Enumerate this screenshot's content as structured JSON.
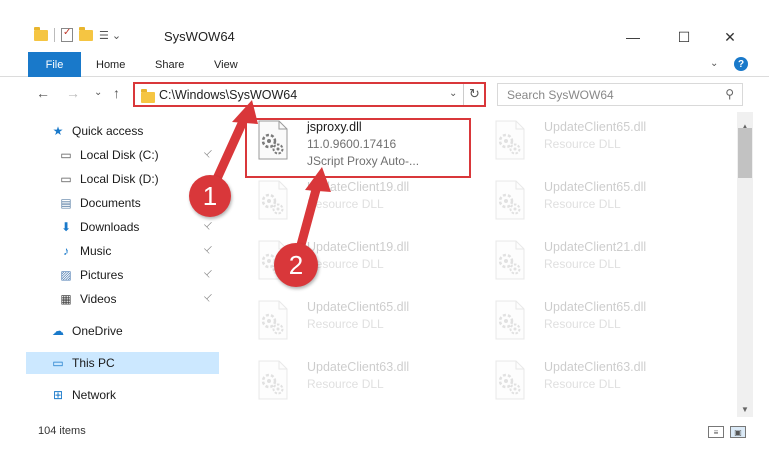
{
  "window": {
    "title": "SysWOW64",
    "minimize": "—",
    "maximize": "☐",
    "close": "✕"
  },
  "ribbon": {
    "tabs": [
      "File",
      "Home",
      "Share",
      "View"
    ],
    "expand_icon": "⌄",
    "help_icon": "?"
  },
  "nav": {
    "back": "←",
    "forward": "→",
    "recent": "⌄",
    "up": "↑",
    "address": "C:\\Windows\\SysWOW64",
    "address_dropdown": "⌄",
    "refresh": "↻",
    "search_placeholder": "Search SysWOW64",
    "search_icon": "⚲"
  },
  "sidebar": {
    "items": [
      {
        "label": "Quick access",
        "icon": "star-icon",
        "glyph": "★",
        "color": "#1979ca"
      },
      {
        "label": "Local Disk (C:)",
        "icon": "drive-icon",
        "glyph": "▭",
        "color": "#555555",
        "pinned": true
      },
      {
        "label": "Local Disk (D:)",
        "icon": "drive-icon",
        "glyph": "▭",
        "color": "#555555"
      },
      {
        "label": "Documents",
        "icon": "documents-icon",
        "glyph": "▤",
        "color": "#5b7fa6"
      },
      {
        "label": "Downloads",
        "icon": "download-icon",
        "glyph": "⬇",
        "color": "#1979ca",
        "pinned": true
      },
      {
        "label": "Music",
        "icon": "music-icon",
        "glyph": "♪",
        "color": "#1979ca",
        "pinned": true
      },
      {
        "label": "Pictures",
        "icon": "pictures-icon",
        "glyph": "▨",
        "color": "#4a7ab0",
        "pinned": true
      },
      {
        "label": "Videos",
        "icon": "video-icon",
        "glyph": "▦",
        "color": "#444444",
        "pinned": true
      },
      {
        "label": "OneDrive",
        "icon": "cloud-icon",
        "glyph": "☁",
        "color": "#1979ca"
      },
      {
        "label": "This PC",
        "icon": "computer-icon",
        "glyph": "▭",
        "color": "#1979ca",
        "selected": true
      },
      {
        "label": "Network",
        "icon": "network-icon",
        "glyph": "⊞",
        "color": "#1979ca"
      }
    ],
    "pin_glyph": "📌"
  },
  "files": [
    {
      "name": "jsproxy.dll",
      "line2": "11.0.9600.17416",
      "line3": "JScript Proxy Auto-...",
      "highlighted": true
    },
    {
      "name": "UpdateClient65.dll",
      "line2": "Resource DLL"
    },
    {
      "name": "UpdateClient19.dll",
      "line2": "Resource DLL"
    },
    {
      "name": "UpdateClient65.dll",
      "line2": "Resource DLL"
    },
    {
      "name": "UpdateClient19.dll",
      "line2": "Resource DLL"
    },
    {
      "name": "UpdateClient21.dll",
      "line2": "Resource DLL"
    },
    {
      "name": "UpdateClient65.dll",
      "line2": "Resource DLL"
    },
    {
      "name": "UpdateClient65.dll",
      "line2": "Resource DLL"
    },
    {
      "name": "UpdateClient63.dll",
      "line2": "Resource DLL"
    },
    {
      "name": "UpdateClient63.dll",
      "line2": "Resource DLL"
    }
  ],
  "status": {
    "item_count": "104 items"
  },
  "annotations": {
    "step1": "1",
    "step2": "2",
    "color": "#d9373a"
  }
}
